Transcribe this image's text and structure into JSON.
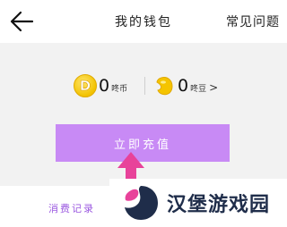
{
  "header": {
    "title": "我的钱包",
    "faq_label": "常见问题"
  },
  "wallet": {
    "coin": {
      "icon_letter": "D",
      "amount": "0",
      "unit": "咚币"
    },
    "bean": {
      "amount": "0",
      "unit": "咚豆",
      "chevron": ">"
    }
  },
  "recharge": {
    "label": "立即充值"
  },
  "tabs": {
    "records_label": "消费记录"
  },
  "watermark": {
    "text": "汉堡游戏园"
  },
  "colors": {
    "button": "#c88af5",
    "arrow": "#e8429a",
    "coin": "#f2c200",
    "bean": "#f5c400",
    "panel_bg": "#f2f2f2"
  }
}
